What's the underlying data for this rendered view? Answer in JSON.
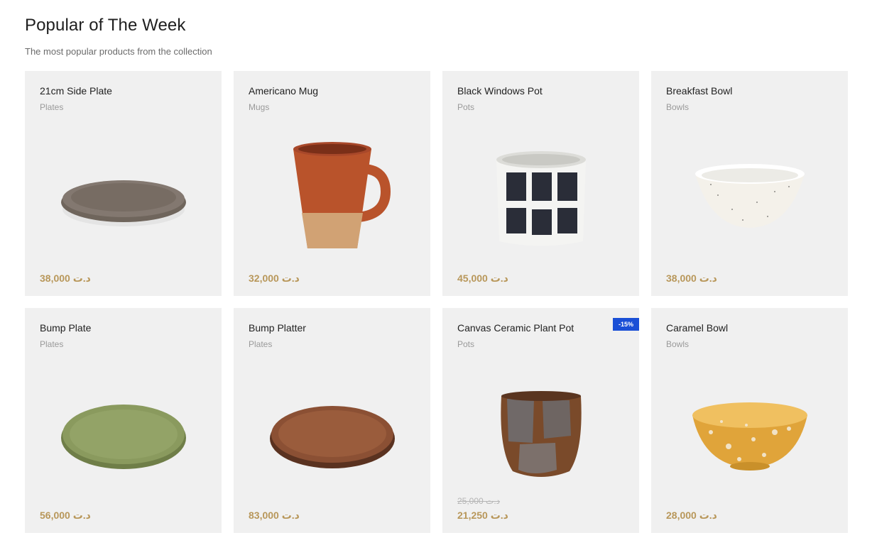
{
  "section": {
    "title": "Popular of The Week",
    "subtitle": "The most popular products from the collection"
  },
  "products": [
    {
      "name": "21cm Side Plate",
      "category": "Plates",
      "price": "38,000 د.ت",
      "image": "plate-gray-icon",
      "color": "#7d7268"
    },
    {
      "name": "Americano Mug",
      "category": "Mugs",
      "price": "32,000 د.ت",
      "image": "mug-icon",
      "color": "#b9532b"
    },
    {
      "name": "Black Windows Pot",
      "category": "Pots",
      "price": "45,000 د.ت",
      "image": "pot-windows-icon",
      "color": "#2a2d38"
    },
    {
      "name": "Breakfast Bowl",
      "category": "Bowls",
      "price": "38,000 د.ت",
      "image": "bowl-white-icon",
      "color": "#f4f1ea"
    },
    {
      "name": "Bump Plate",
      "category": "Plates",
      "price": "56,000 د.ت",
      "image": "plate-green-icon",
      "color": "#8a9a5e"
    },
    {
      "name": "Bump Platter",
      "category": "Plates",
      "price": "83,000 د.ت",
      "image": "plate-brown-icon",
      "color": "#8b5034"
    },
    {
      "name": "Canvas Ceramic Plant Pot",
      "category": "Pots",
      "price": "21,250 د.ت",
      "old_price": "25,000 د.ت",
      "badge": "-15%",
      "image": "pot-canvas-icon",
      "color": "#7a4a2a"
    },
    {
      "name": "Caramel Bowl",
      "category": "Bowls",
      "price": "28,000 د.ت",
      "image": "bowl-caramel-icon",
      "color": "#e0a43a"
    }
  ]
}
